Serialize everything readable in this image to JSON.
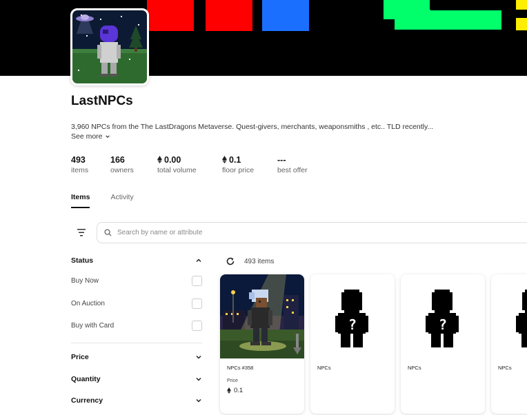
{
  "collection": {
    "name": "LastNPCs",
    "description": "3,960 NPCs from the The LastDragons Metaverse. Quest-givers, merchants, weaponsmiths , etc.. TLD recently...",
    "see_more": "See more"
  },
  "stats": [
    {
      "value": "493",
      "label": "items",
      "eth": false
    },
    {
      "value": "166",
      "label": "owners",
      "eth": false
    },
    {
      "value": "0.00",
      "label": "total volume",
      "eth": true
    },
    {
      "value": "0.1",
      "label": "floor price",
      "eth": true
    },
    {
      "value": "---",
      "label": "best offer",
      "eth": false
    }
  ],
  "tabs": [
    {
      "label": "Items",
      "active": true
    },
    {
      "label": "Activity",
      "active": false
    }
  ],
  "search": {
    "placeholder": "Search by name or attribute"
  },
  "filters": {
    "status_label": "Status",
    "status_options": [
      "Buy Now",
      "On Auction",
      "Buy with Card"
    ],
    "price_label": "Price",
    "quantity_label": "Quantity",
    "currency_label": "Currency"
  },
  "results": {
    "count_text": "493 items"
  },
  "cards": [
    {
      "name": "NPCs #358",
      "price_label": "Price",
      "price": "0.1",
      "image": "npc-character"
    },
    {
      "name": "NPCs",
      "price_label": "",
      "price": "",
      "image": "mystery-silhouette"
    },
    {
      "name": "NPCs",
      "price_label": "",
      "price": "",
      "image": "mystery-silhouette"
    },
    {
      "name": "NPCs",
      "price_label": "",
      "price": "",
      "image": "mystery-silhouette"
    }
  ],
  "icons": {
    "filter": "filter-icon",
    "search": "search-icon",
    "refresh": "refresh-icon",
    "chevron_up": "chevron-up-icon",
    "chevron_down": "chevron-down-icon",
    "eth": "ethereum-icon"
  },
  "colors": {
    "banner_red": "#ff0000",
    "banner_blue": "#1a6fff",
    "banner_green": "#00ff6a",
    "banner_yellow": "#ffee00"
  }
}
